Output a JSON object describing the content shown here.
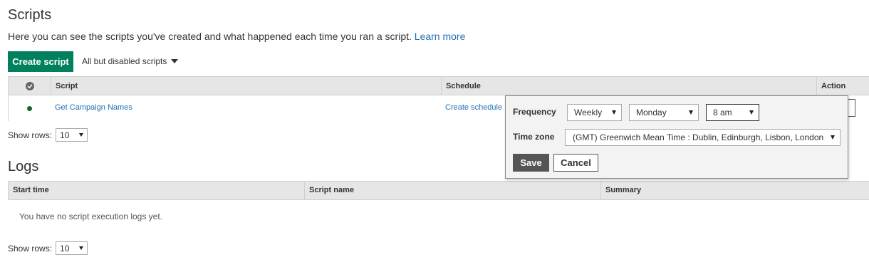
{
  "scripts": {
    "title": "Scripts",
    "description": "Here you can see the scripts you've created and what happened each time you ran a script.",
    "learn_more": "Learn more",
    "create_button": "Create script",
    "filter": "All but disabled scripts",
    "columns": {
      "script": "Script",
      "schedule": "Schedule",
      "action": "Action"
    },
    "rows": [
      {
        "name": "Get Campaign Names",
        "schedule": "Create schedule",
        "status": "enabled"
      }
    ],
    "show_rows_label": "Show rows:",
    "show_rows_value": "10"
  },
  "logs": {
    "title": "Logs",
    "columns": {
      "start_time": "Start time",
      "script_name": "Script name",
      "summary": "Summary"
    },
    "empty_message": "You have no script execution logs yet.",
    "show_rows_label": "Show rows:",
    "show_rows_value": "10"
  },
  "schedule_popup": {
    "frequency_label": "Frequency",
    "frequency_value": "Weekly",
    "day_value": "Monday",
    "time_value": "8 am",
    "timezone_label": "Time zone",
    "timezone_value": "(GMT) Greenwich Mean Time : Dublin, Edinburgh, Lisbon, London",
    "save_label": "Save",
    "cancel_label": "Cancel"
  },
  "colors": {
    "primary_button": "#00805c",
    "link": "#1f6fb3",
    "status_enabled": "#0e6b2e",
    "header_bg": "#e6e6e6"
  },
  "icons": {
    "status_header": "check-circle-icon",
    "filter_toggle": "triangle-down-icon",
    "select_toggle": "triangle-down-icon"
  }
}
